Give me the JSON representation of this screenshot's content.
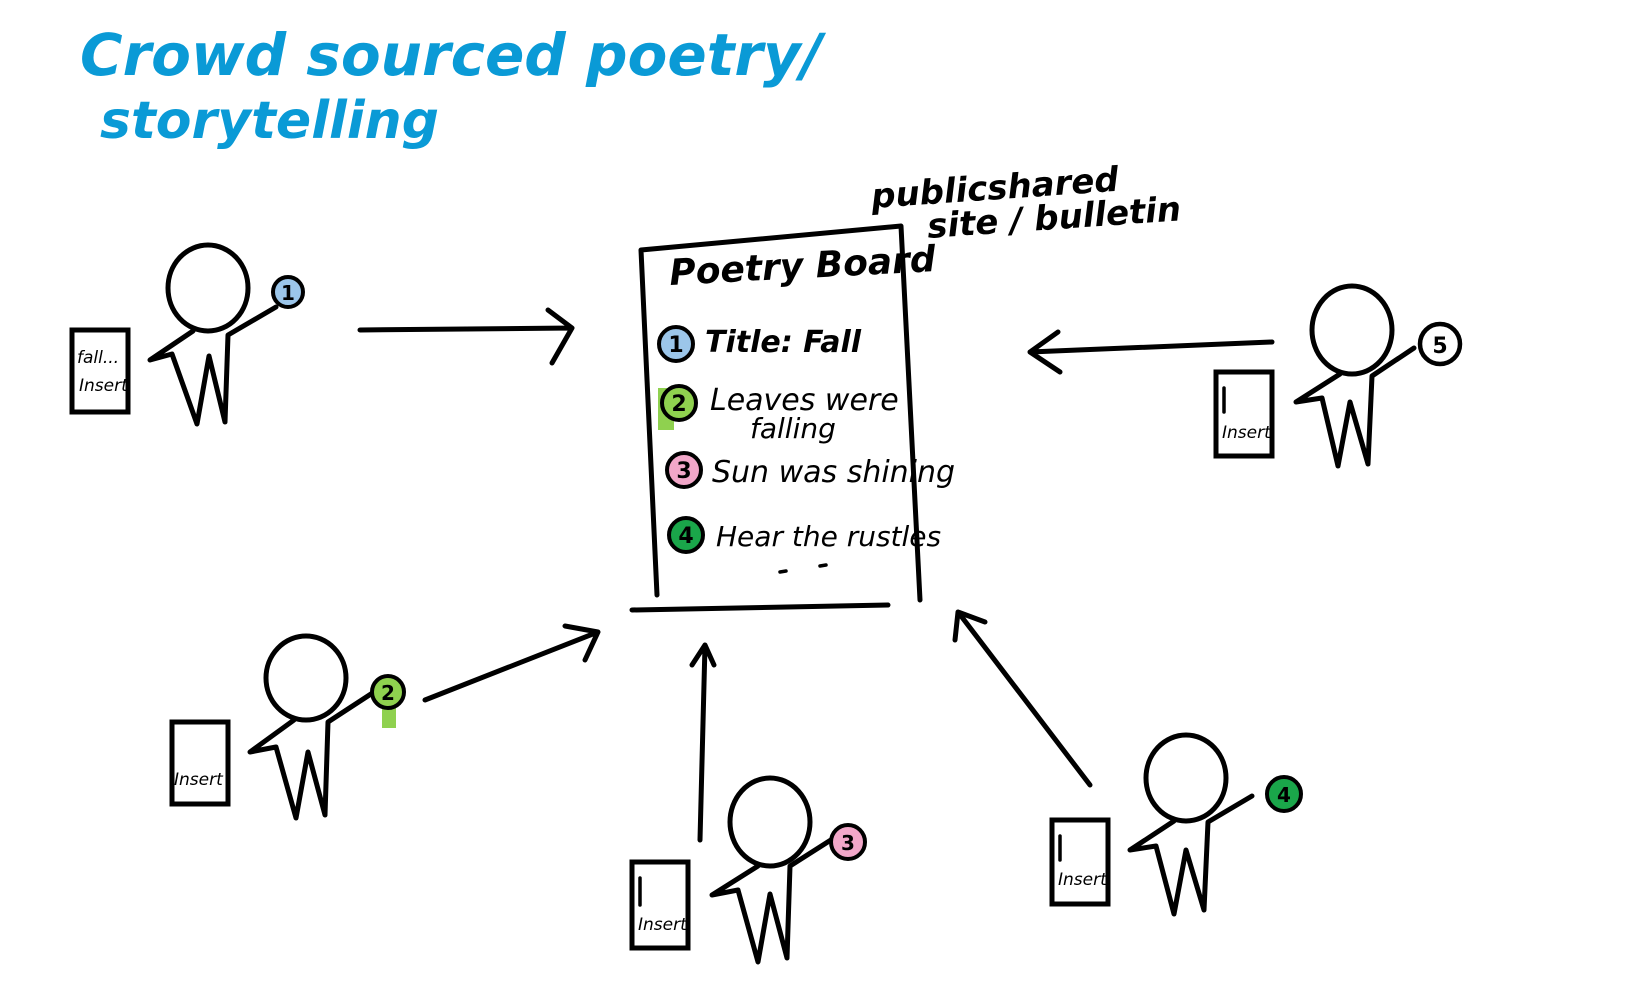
{
  "title": {
    "line1": "Crowd sourced poetry/",
    "line2": "storytelling",
    "color": "#0a9ad6"
  },
  "board": {
    "caption_line1": "publicshared",
    "caption_line2": "site / bulletin",
    "heading": "Poetry Board",
    "entries": [
      {
        "num": "1",
        "text": "Title: Fall",
        "color": "#9cc6ea",
        "bold": true
      },
      {
        "num": "2",
        "text_line1": "Leaves were",
        "text_line2": "falling",
        "color": "#8fd14f"
      },
      {
        "num": "3",
        "text": "Sun was shining",
        "color": "#f2a7c9"
      },
      {
        "num": "4",
        "text": "Hear the rustles",
        "color": "#1aa64a"
      }
    ]
  },
  "contributors": [
    {
      "num": "1",
      "color": "#9cc6ea",
      "card_line1": "fall...",
      "card_line2": "Insert"
    },
    {
      "num": "2",
      "color": "#8fd14f",
      "card_line1": "",
      "card_line2": "Insert"
    },
    {
      "num": "3",
      "color": "#f2a7c9",
      "card_line1": "",
      "card_line2": "Insert"
    },
    {
      "num": "4",
      "color": "#1aa64a",
      "card_line1": "",
      "card_line2": "Insert"
    },
    {
      "num": "5",
      "color": "#ffffff",
      "card_line1": "",
      "card_line2": "Insert"
    }
  ]
}
